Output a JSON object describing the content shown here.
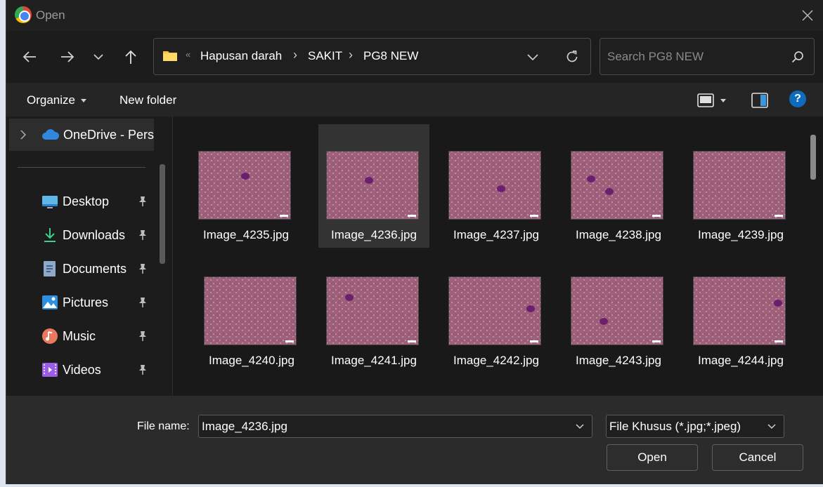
{
  "window": {
    "title": "Open"
  },
  "nav": {
    "breadcrumb": [
      "Hapusan darah",
      "SAKIT",
      "PG8 NEW"
    ],
    "breadcrumb_overflow": "«",
    "search_placeholder": "Search PG8 NEW"
  },
  "commands": {
    "organize": "Organize",
    "new_folder": "New folder"
  },
  "sidebar": {
    "onedrive": "OneDrive - Perso",
    "items": [
      {
        "label": "Desktop",
        "icon": "desktop-icon"
      },
      {
        "label": "Downloads",
        "icon": "download-icon"
      },
      {
        "label": "Documents",
        "icon": "document-icon"
      },
      {
        "label": "Pictures",
        "icon": "pictures-icon"
      },
      {
        "label": "Music",
        "icon": "music-icon"
      },
      {
        "label": "Videos",
        "icon": "video-icon"
      }
    ]
  },
  "files": [
    "Image_4235.jpg",
    "Image_4236.jpg",
    "Image_4237.jpg",
    "Image_4238.jpg",
    "Image_4239.jpg",
    "Image_4240.jpg",
    "Image_4241.jpg",
    "Image_4242.jpg",
    "Image_4243.jpg",
    "Image_4244.jpg"
  ],
  "selected_file_index": 1,
  "footer": {
    "file_name_label": "File name:",
    "file_name_value": "Image_4236.jpg",
    "file_type": "File Khusus (*.jpg;*.jpeg)",
    "open_label": "Open",
    "cancel_label": "Cancel"
  },
  "colors": {
    "accent": "#0f6cbd",
    "folder": "#f4c542",
    "window_bg": "#202020"
  }
}
